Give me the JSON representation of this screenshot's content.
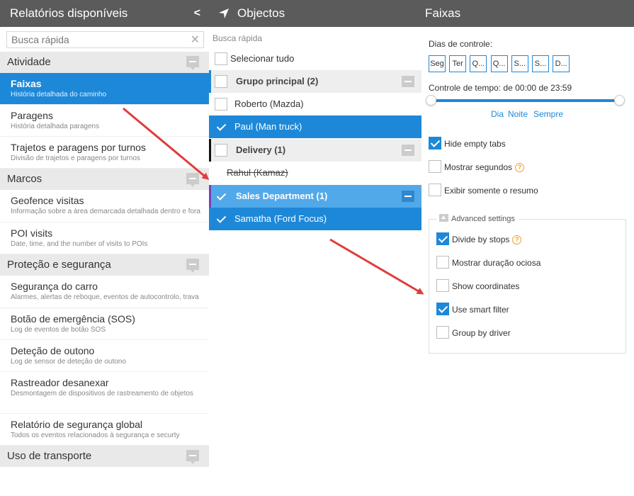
{
  "left": {
    "title": "Relatórios disponíveis",
    "collapse_icon": "chevron-left-icon",
    "search_placeholder": "Busca rápida",
    "categories": [
      {
        "name": "Atividade",
        "reports": [
          {
            "title": "Faixas",
            "desc": "História detalhada do caminho",
            "active": true
          },
          {
            "title": "Paragens",
            "desc": "História detalhada paragens"
          },
          {
            "title": "Trajetos e paragens por turnos",
            "desc": "Divisão de trajetos e paragens por turnos"
          }
        ]
      },
      {
        "name": "Marcos",
        "reports": [
          {
            "title": "Geofence visitas",
            "desc": "Informação sobre a área demarcada detalhada dentro e fora"
          },
          {
            "title": "POI visits",
            "desc": "Date, time, and the number of visits to POIs"
          }
        ]
      },
      {
        "name": "Proteção e segurança",
        "reports": [
          {
            "title": "Segurança do carro",
            "desc": "Alarmes, alertas de reboque, eventos de autocontrolo, trava"
          },
          {
            "title": "Botão de emergência (SOS)",
            "desc": "Log de eventos de botão SOS"
          },
          {
            "title": "Deteção de outono",
            "desc": "Log de sensor de deteção de outono"
          },
          {
            "title": "Rastreador desanexar",
            "desc": "Desmontagem de dispositivos de rastreamento de objetos"
          },
          {
            "title": "Relatório de segurança global",
            "desc": "Todos os eventos relacionados à segurança e securty"
          }
        ]
      },
      {
        "name": "Uso de transporte",
        "reports": []
      }
    ]
  },
  "middle": {
    "title": "Objectos",
    "title_icon": "navigation-arrow-icon",
    "search_placeholder": "Busca rápida",
    "select_all": "Selecionar tudo",
    "rows": [
      {
        "kind": "group",
        "label": "Grupo principal (2)",
        "checked": false
      },
      {
        "kind": "item",
        "label": "Roberto (Mazda)",
        "checked": false
      },
      {
        "kind": "item",
        "label": "Paul (Man truck)",
        "checked": true
      },
      {
        "kind": "group",
        "label": "Delivery (1)",
        "checked": false
      },
      {
        "kind": "item",
        "label": "Rahul (Kamaz)",
        "checked": false,
        "strikethrough": true
      },
      {
        "kind": "group",
        "label": "Sales Department (1)",
        "checked": true
      },
      {
        "kind": "item",
        "label": "Samatha (Ford Focus)",
        "checked": true
      }
    ]
  },
  "right": {
    "title": "Faixas",
    "days_label": "Dias de controle:",
    "days": [
      "Seg",
      "Ter",
      "Q...",
      "Q...",
      "S...",
      "S...",
      "D..."
    ],
    "time_label": "Controle de tempo: de 00:00 de 23:59",
    "slider": {
      "from": "00:00",
      "to": "23:59"
    },
    "periods": [
      "Dia",
      "Noite",
      "Sempre"
    ],
    "options": [
      {
        "label": "Hide empty tabs",
        "checked": true,
        "help": false
      },
      {
        "label": "Mostrar segundos",
        "checked": false,
        "help": true
      },
      {
        "label": "Exibir somente o resumo",
        "checked": false,
        "help": false
      }
    ],
    "advanced": {
      "title": "Advanced settings",
      "options": [
        {
          "label": "Divide by stops",
          "checked": true,
          "help": true
        },
        {
          "label": "Mostrar duração ociosa",
          "checked": false,
          "help": false
        },
        {
          "label": "Show coordinates",
          "checked": false,
          "help": false
        },
        {
          "label": "Use smart filter",
          "checked": true,
          "help": false
        },
        {
          "label": "Group by driver",
          "checked": false,
          "help": false
        }
      ]
    },
    "help_glyph": "?"
  },
  "colors": {
    "header": "#5b5b5b",
    "accent": "#1e88d8",
    "annotation_arrow": "#e03c3c",
    "help": "#f0a020"
  }
}
